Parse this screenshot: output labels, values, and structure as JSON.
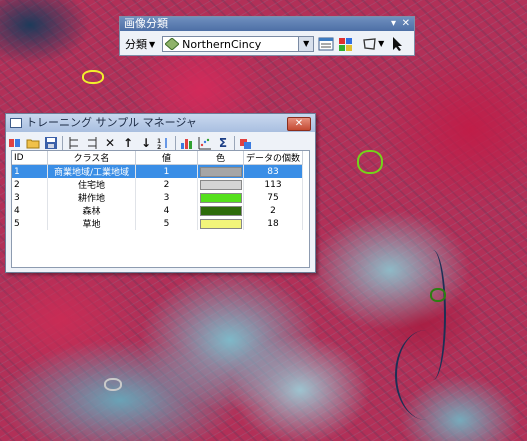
{
  "classify_toolbar": {
    "title": "画像分類",
    "classify_menu": "分類",
    "layer_name": "NorthernCincy"
  },
  "training_manager": {
    "title": "トレーニング サンプル マネージャ",
    "columns": [
      "ID",
      "クラス名",
      "値",
      "色",
      "データの個数"
    ],
    "rows": [
      {
        "id": "1",
        "name": "商業地域/工業地域",
        "value": "1",
        "color": "#a6a6a6",
        "count": "83"
      },
      {
        "id": "2",
        "name": "住宅地",
        "value": "2",
        "color": "#d4d4d4",
        "count": "113"
      },
      {
        "id": "3",
        "name": "耕作地",
        "value": "3",
        "color": "#55e01c",
        "count": "75"
      },
      {
        "id": "4",
        "name": "森林",
        "value": "4",
        "color": "#2d6b0a",
        "count": "2"
      },
      {
        "id": "5",
        "name": "草地",
        "value": "5",
        "color": "#f2f57a",
        "count": "18"
      }
    ],
    "selected_row_index": 0
  }
}
